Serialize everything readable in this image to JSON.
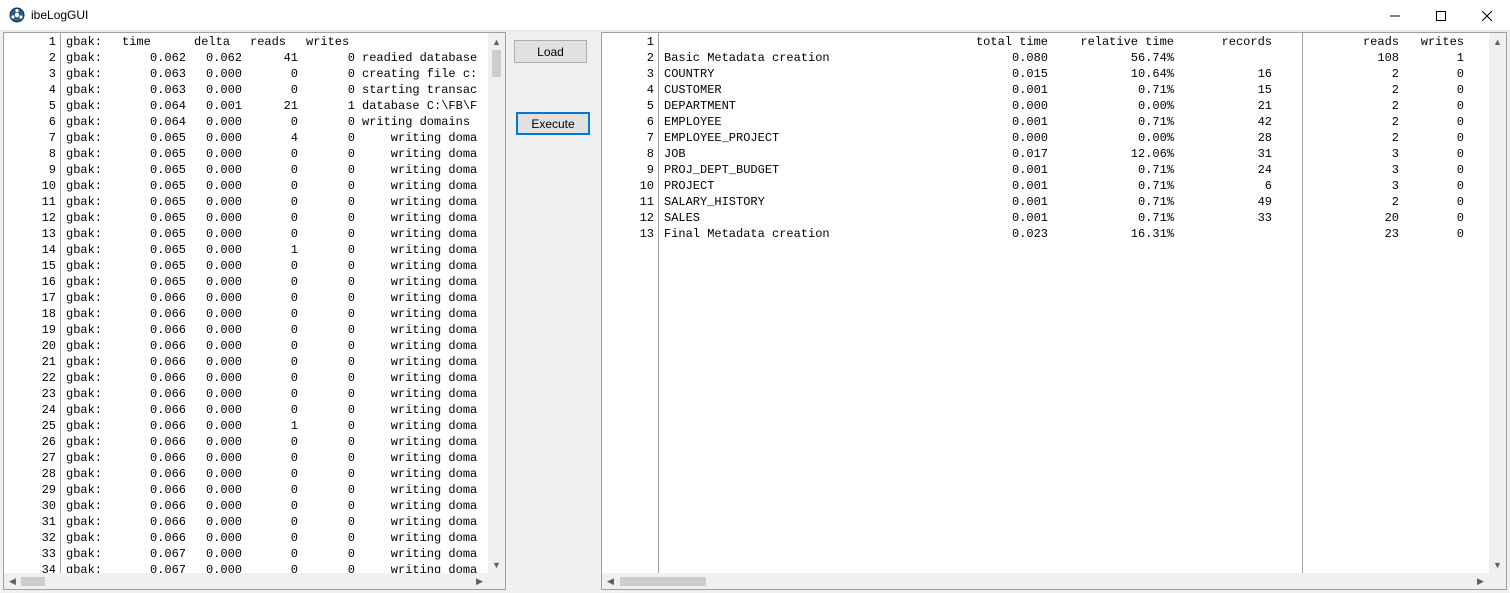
{
  "window": {
    "title": "ibeLogGUI",
    "icon": "gear-ball-icon",
    "minimize": "minimize-icon",
    "maximize": "maximize-icon",
    "close": "close-icon"
  },
  "buttons": {
    "load_label": "Load",
    "execute_label": "Execute"
  },
  "left_log": {
    "header": [
      "gbak:",
      "time",
      "delta",
      "reads",
      "writes"
    ],
    "rows": [
      [
        "gbak:",
        "0.062",
        "0.062",
        "41",
        "0",
        "readied database"
      ],
      [
        "gbak:",
        "0.063",
        "0.000",
        "0",
        "0",
        "creating file c:"
      ],
      [
        "gbak:",
        "0.063",
        "0.000",
        "0",
        "0",
        "starting transac"
      ],
      [
        "gbak:",
        "0.064",
        "0.001",
        "21",
        "1",
        "database C:\\FB\\F"
      ],
      [
        "gbak:",
        "0.064",
        "0.000",
        "0",
        "0",
        "writing domains"
      ],
      [
        "gbak:",
        "0.065",
        "0.000",
        "4",
        "0",
        "    writing doma"
      ],
      [
        "gbak:",
        "0.065",
        "0.000",
        "0",
        "0",
        "    writing doma"
      ],
      [
        "gbak:",
        "0.065",
        "0.000",
        "0",
        "0",
        "    writing doma"
      ],
      [
        "gbak:",
        "0.065",
        "0.000",
        "0",
        "0",
        "    writing doma"
      ],
      [
        "gbak:",
        "0.065",
        "0.000",
        "0",
        "0",
        "    writing doma"
      ],
      [
        "gbak:",
        "0.065",
        "0.000",
        "0",
        "0",
        "    writing doma"
      ],
      [
        "gbak:",
        "0.065",
        "0.000",
        "0",
        "0",
        "    writing doma"
      ],
      [
        "gbak:",
        "0.065",
        "0.000",
        "1",
        "0",
        "    writing doma"
      ],
      [
        "gbak:",
        "0.065",
        "0.000",
        "0",
        "0",
        "    writing doma"
      ],
      [
        "gbak:",
        "0.065",
        "0.000",
        "0",
        "0",
        "    writing doma"
      ],
      [
        "gbak:",
        "0.066",
        "0.000",
        "0",
        "0",
        "    writing doma"
      ],
      [
        "gbak:",
        "0.066",
        "0.000",
        "0",
        "0",
        "    writing doma"
      ],
      [
        "gbak:",
        "0.066",
        "0.000",
        "0",
        "0",
        "    writing doma"
      ],
      [
        "gbak:",
        "0.066",
        "0.000",
        "0",
        "0",
        "    writing doma"
      ],
      [
        "gbak:",
        "0.066",
        "0.000",
        "0",
        "0",
        "    writing doma"
      ],
      [
        "gbak:",
        "0.066",
        "0.000",
        "0",
        "0",
        "    writing doma"
      ],
      [
        "gbak:",
        "0.066",
        "0.000",
        "0",
        "0",
        "    writing doma"
      ],
      [
        "gbak:",
        "0.066",
        "0.000",
        "0",
        "0",
        "    writing doma"
      ],
      [
        "gbak:",
        "0.066",
        "0.000",
        "1",
        "0",
        "    writing doma"
      ],
      [
        "gbak:",
        "0.066",
        "0.000",
        "0",
        "0",
        "    writing doma"
      ],
      [
        "gbak:",
        "0.066",
        "0.000",
        "0",
        "0",
        "    writing doma"
      ],
      [
        "gbak:",
        "0.066",
        "0.000",
        "0",
        "0",
        "    writing doma"
      ],
      [
        "gbak:",
        "0.066",
        "0.000",
        "0",
        "0",
        "    writing doma"
      ],
      [
        "gbak:",
        "0.066",
        "0.000",
        "0",
        "0",
        "    writing doma"
      ],
      [
        "gbak:",
        "0.066",
        "0.000",
        "0",
        "0",
        "    writing doma"
      ],
      [
        "gbak:",
        "0.066",
        "0.000",
        "0",
        "0",
        "    writing doma"
      ],
      [
        "gbak:",
        "0.067",
        "0.000",
        "0",
        "0",
        "    writing doma"
      ],
      [
        "gbak:",
        "0.067",
        "0.000",
        "0",
        "0",
        "    writing doma"
      ]
    ]
  },
  "right_report": {
    "header": [
      "",
      "total time",
      "relative time",
      "records",
      "reads",
      "writes"
    ],
    "rows": [
      [
        "Basic Metadata creation",
        "0.080",
        "56.74%",
        "",
        "108",
        "1"
      ],
      [
        "COUNTRY",
        "0.015",
        "10.64%",
        "16",
        "2",
        "0"
      ],
      [
        "CUSTOMER",
        "0.001",
        "0.71%",
        "15",
        "2",
        "0"
      ],
      [
        "DEPARTMENT",
        "0.000",
        "0.00%",
        "21",
        "2",
        "0"
      ],
      [
        "EMPLOYEE",
        "0.001",
        "0.71%",
        "42",
        "2",
        "0"
      ],
      [
        "EMPLOYEE_PROJECT",
        "0.000",
        "0.00%",
        "28",
        "2",
        "0"
      ],
      [
        "JOB",
        "0.017",
        "12.06%",
        "31",
        "3",
        "0"
      ],
      [
        "PROJ_DEPT_BUDGET",
        "0.001",
        "0.71%",
        "24",
        "3",
        "0"
      ],
      [
        "PROJECT",
        "0.001",
        "0.71%",
        "6",
        "3",
        "0"
      ],
      [
        "SALARY_HISTORY",
        "0.001",
        "0.71%",
        "49",
        "2",
        "0"
      ],
      [
        "SALES",
        "0.001",
        "0.71%",
        "33",
        "20",
        "0"
      ],
      [
        "Final Metadata creation",
        "0.023",
        "16.31%",
        "",
        "23",
        "0"
      ]
    ]
  }
}
